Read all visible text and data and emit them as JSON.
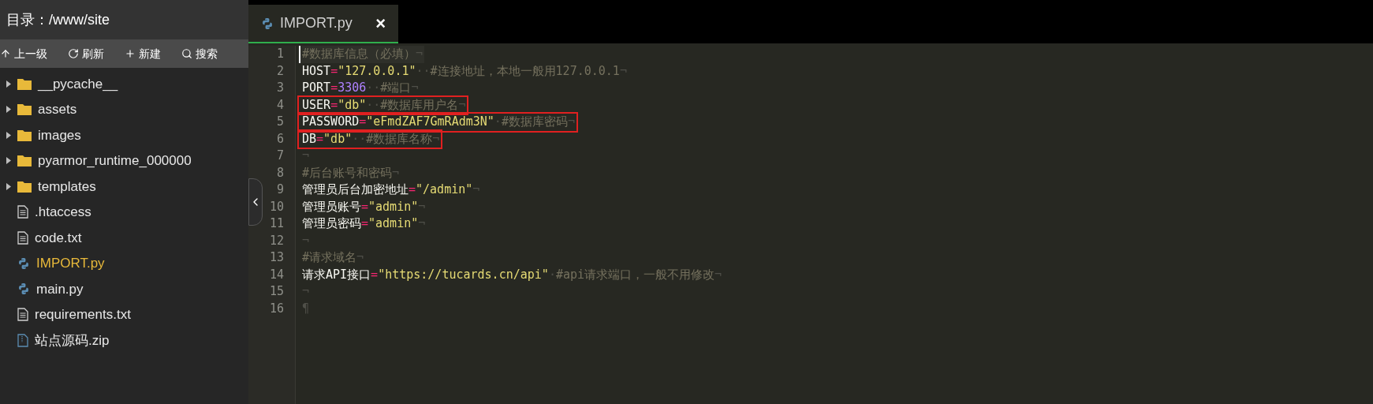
{
  "sidebar": {
    "title": "目录：/www/site",
    "toolbar": [
      {
        "kind": "up",
        "label": "上一级"
      },
      {
        "kind": "refresh",
        "label": "刷新"
      },
      {
        "kind": "new",
        "label": "新建"
      },
      {
        "kind": "search",
        "label": "搜索"
      }
    ],
    "files": [
      {
        "kind": "folder",
        "name": "__pycache__",
        "selected": false
      },
      {
        "kind": "folder",
        "name": "assets",
        "selected": false
      },
      {
        "kind": "folder",
        "name": "images",
        "selected": false
      },
      {
        "kind": "folder",
        "name": "pyarmor_runtime_000000",
        "selected": false
      },
      {
        "kind": "folder",
        "name": "templates",
        "selected": false
      },
      {
        "kind": "text",
        "name": ".htaccess",
        "selected": false
      },
      {
        "kind": "text",
        "name": "code.txt",
        "selected": false
      },
      {
        "kind": "python",
        "name": "IMPORT.py",
        "selected": true
      },
      {
        "kind": "python",
        "name": "main.py",
        "selected": false
      },
      {
        "kind": "text",
        "name": "requirements.txt",
        "selected": false
      },
      {
        "kind": "zip",
        "name": "站点源码.zip",
        "selected": false
      }
    ]
  },
  "tabs": [
    {
      "label": "IMPORT.py",
      "close": "×",
      "selected": true
    }
  ],
  "editor": {
    "lines": [
      {
        "number": "1",
        "cursor": true,
        "boxed": false,
        "tokens": [
          {
            "kind": "comment",
            "text": "#数据库信息（必填）"
          },
          {
            "kind": "mark",
            "text": "¬"
          }
        ]
      },
      {
        "number": "2",
        "cursor": false,
        "boxed": false,
        "tokens": [
          {
            "kind": "name",
            "text": "HOST"
          },
          {
            "kind": "op",
            "text": "="
          },
          {
            "kind": "string",
            "text": "\"127.0.0.1\""
          },
          {
            "kind": "mark",
            "text": "··"
          },
          {
            "kind": "comment",
            "text": "#连接地址，本地一般用127.0.0.1"
          },
          {
            "kind": "mark",
            "text": "¬"
          }
        ]
      },
      {
        "number": "3",
        "cursor": false,
        "boxed": false,
        "tokens": [
          {
            "kind": "name",
            "text": "PORT"
          },
          {
            "kind": "op",
            "text": "="
          },
          {
            "kind": "number",
            "text": "3306"
          },
          {
            "kind": "mark",
            "text": "··"
          },
          {
            "kind": "comment",
            "text": "#端口"
          },
          {
            "kind": "mark",
            "text": "¬"
          }
        ]
      },
      {
        "number": "4",
        "cursor": false,
        "boxed": true,
        "tokens": [
          {
            "kind": "name",
            "text": "USER"
          },
          {
            "kind": "op",
            "text": "="
          },
          {
            "kind": "string",
            "text": "\"db\""
          },
          {
            "kind": "mark",
            "text": "··"
          },
          {
            "kind": "comment",
            "text": "#数据库用户名"
          },
          {
            "kind": "mark",
            "text": "¬"
          }
        ]
      },
      {
        "number": "5",
        "cursor": false,
        "boxed": true,
        "tokens": [
          {
            "kind": "name",
            "text": "PASSWORD"
          },
          {
            "kind": "op",
            "text": "="
          },
          {
            "kind": "string",
            "text": "\"eFmdZAF7GmRAdm3N\""
          },
          {
            "kind": "mark",
            "text": "·"
          },
          {
            "kind": "comment",
            "text": "#数据库密码"
          },
          {
            "kind": "mark",
            "text": "¬"
          }
        ]
      },
      {
        "number": "6",
        "cursor": false,
        "boxed": true,
        "tokens": [
          {
            "kind": "name",
            "text": "DB"
          },
          {
            "kind": "op",
            "text": "="
          },
          {
            "kind": "string",
            "text": "\"db\""
          },
          {
            "kind": "mark",
            "text": "··"
          },
          {
            "kind": "comment",
            "text": "#数据库名称"
          },
          {
            "kind": "mark",
            "text": "¬"
          }
        ]
      },
      {
        "number": "7",
        "cursor": false,
        "boxed": false,
        "tokens": [
          {
            "kind": "mark",
            "text": "¬"
          }
        ]
      },
      {
        "number": "8",
        "cursor": false,
        "boxed": false,
        "tokens": [
          {
            "kind": "comment",
            "text": "#后台账号和密码"
          },
          {
            "kind": "mark",
            "text": "¬"
          }
        ]
      },
      {
        "number": "9",
        "cursor": false,
        "boxed": false,
        "tokens": [
          {
            "kind": "name",
            "text": "管理员后台加密地址"
          },
          {
            "kind": "op",
            "text": "="
          },
          {
            "kind": "string",
            "text": "\"/admin\""
          },
          {
            "kind": "mark",
            "text": "¬"
          }
        ]
      },
      {
        "number": "10",
        "cursor": false,
        "boxed": false,
        "tokens": [
          {
            "kind": "name",
            "text": "管理员账号"
          },
          {
            "kind": "op",
            "text": "="
          },
          {
            "kind": "string",
            "text": "\"admin\""
          },
          {
            "kind": "mark",
            "text": "¬"
          }
        ]
      },
      {
        "number": "11",
        "cursor": false,
        "boxed": false,
        "tokens": [
          {
            "kind": "name",
            "text": "管理员密码"
          },
          {
            "kind": "op",
            "text": "="
          },
          {
            "kind": "string",
            "text": "\"admin\""
          },
          {
            "kind": "mark",
            "text": "¬"
          }
        ]
      },
      {
        "number": "12",
        "cursor": false,
        "boxed": false,
        "tokens": [
          {
            "kind": "mark",
            "text": "¬"
          }
        ]
      },
      {
        "number": "13",
        "cursor": false,
        "boxed": false,
        "tokens": [
          {
            "kind": "comment",
            "text": "#请求域名"
          },
          {
            "kind": "mark",
            "text": "¬"
          }
        ]
      },
      {
        "number": "14",
        "cursor": false,
        "boxed": false,
        "tokens": [
          {
            "kind": "name",
            "text": "请求API接口"
          },
          {
            "kind": "op",
            "text": "="
          },
          {
            "kind": "string",
            "text": "\"https://tucards.cn/api\""
          },
          {
            "kind": "mark",
            "text": "·"
          },
          {
            "kind": "comment",
            "text": "#api请求端口，一般不用修改"
          },
          {
            "kind": "mark",
            "text": "¬"
          }
        ]
      },
      {
        "number": "15",
        "cursor": false,
        "boxed": false,
        "tokens": [
          {
            "kind": "mark",
            "text": "¬"
          }
        ]
      },
      {
        "number": "16",
        "cursor": false,
        "boxed": false,
        "tokens": [
          {
            "kind": "mark",
            "text": "¶"
          }
        ]
      }
    ]
  }
}
